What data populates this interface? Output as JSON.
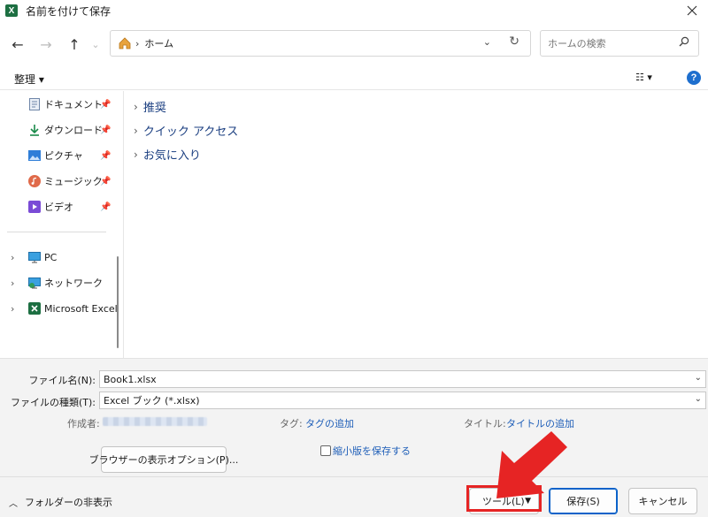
{
  "window": {
    "title": "名前を付けて保存",
    "app_icon": "X"
  },
  "nav": {
    "back": "←",
    "forward": "→",
    "up": "↑",
    "address": {
      "separator": "›",
      "location": "ホーム"
    },
    "search_placeholder": "ホームの検索"
  },
  "toolbar": {
    "organize": "整理 ▾",
    "view": "☷ ▾",
    "help": "?"
  },
  "sidebar": {
    "quick": [
      {
        "label": "ドキュメント",
        "icon": "document-icon"
      },
      {
        "label": "ダウンロード",
        "icon": "download-icon"
      },
      {
        "label": "ピクチャ",
        "icon": "pictures-icon"
      },
      {
        "label": "ミュージック",
        "icon": "music-icon"
      },
      {
        "label": "ビデオ",
        "icon": "video-icon"
      }
    ],
    "tree": [
      {
        "label": "PC",
        "icon": "pc-icon"
      },
      {
        "label": "ネットワーク",
        "icon": "network-icon"
      },
      {
        "label": "Microsoft Excel",
        "icon": "excel-icon"
      }
    ]
  },
  "main": {
    "groups": [
      "推奨",
      "クイック アクセス",
      "お気に入り"
    ]
  },
  "form": {
    "filename_label": "ファイル名(N):",
    "filename_value": "Book1.xlsx",
    "filetype_label": "ファイルの種類(T):",
    "filetype_value": "Excel ブック (*.xlsx)",
    "author_label": "作成者:",
    "tags_label": "タグ:",
    "tags_link": "タグの追加",
    "title_label": "タイトル:",
    "title_link": "タイトルの追加",
    "browser_options": "ブラウザーの表示オプション(P)...",
    "thumbnail_label": "縮小版を保存する",
    "thumbnail_checked": false
  },
  "footer": {
    "hide_folders": "フォルダーの非表示",
    "tools": "ツール(L)",
    "save": "保存(S)",
    "cancel": "キャンセル"
  },
  "colors": {
    "accent": "#1e6fce",
    "highlight": "#e62424",
    "excel": "#1d6f42",
    "link": "#1e5eb8"
  }
}
